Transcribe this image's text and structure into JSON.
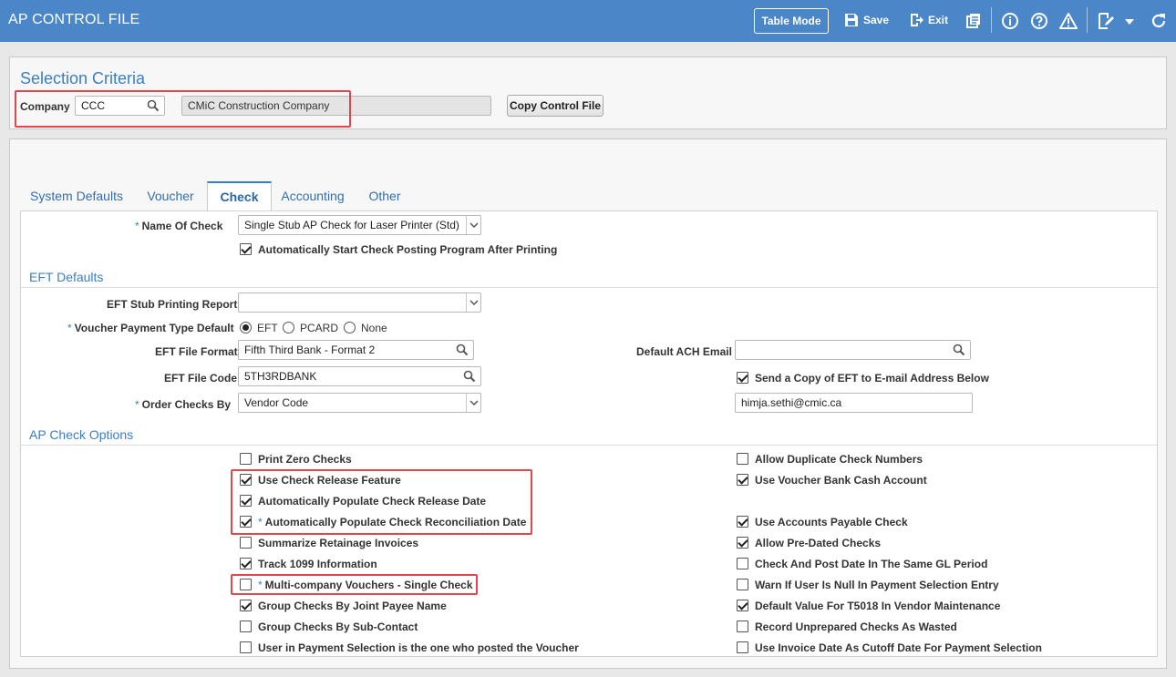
{
  "header": {
    "title": "AP CONTROL FILE",
    "table_mode": "Table Mode",
    "save": "Save",
    "exit": "Exit"
  },
  "selection": {
    "title": "Selection Criteria",
    "company_label": "Company",
    "company_value": "CCC",
    "company_name": "CMiC Construction Company",
    "copy_button": "Copy Control File"
  },
  "tabs": [
    "System Defaults",
    "Voucher",
    "Check",
    "Accounting",
    "Other"
  ],
  "active_tab": "Check",
  "check": {
    "name_of_check_label": "Name Of Check",
    "name_of_check_value": "Single Stub AP Check for Laser Printer (Std)",
    "auto_start_label": "Automatically Start Check Posting Program After Printing",
    "auto_start_checked": true
  },
  "eft": {
    "section_title": "EFT Defaults",
    "stub_report_label": "EFT Stub Printing Report",
    "stub_report_value": "",
    "payment_type_label": "Voucher Payment Type Default",
    "payment_options": [
      "EFT",
      "PCARD",
      "None"
    ],
    "payment_selected": "EFT",
    "file_format_label": "EFT File Format",
    "file_format_value": "Fifth Third Bank - Format 2",
    "file_code_label": "EFT File Code",
    "file_code_value": "5TH3RDBANK",
    "order_checks_label": "Order Checks By",
    "order_checks_value": "Vendor Code",
    "ach_email_label": "Default ACH Email",
    "ach_email_value": "",
    "send_copy_label": "Send a Copy of EFT to E-mail Address Below",
    "send_copy_checked": true,
    "email_value": "himja.sethi@cmic.ca"
  },
  "options": {
    "section_title": "AP Check Options",
    "left": [
      {
        "label": "Print Zero Checks",
        "checked": false,
        "required": false
      },
      {
        "label": "Use Check Release Feature",
        "checked": true,
        "required": false
      },
      {
        "label": "Automatically Populate Check Release Date",
        "checked": true,
        "required": false
      },
      {
        "label": "Automatically Populate Check Reconciliation Date",
        "checked": true,
        "required": true
      },
      {
        "label": "Summarize Retainage Invoices",
        "checked": false,
        "required": false
      },
      {
        "label": "Track 1099 Information",
        "checked": true,
        "required": false
      },
      {
        "label": "Multi-company Vouchers - Single Check",
        "checked": false,
        "required": true
      },
      {
        "label": "Group Checks By Joint Payee Name",
        "checked": true,
        "required": false
      },
      {
        "label": "Group Checks By Sub-Contact",
        "checked": false,
        "required": false
      },
      {
        "label": "User in Payment Selection is the one who posted the Voucher",
        "checked": false,
        "required": false
      }
    ],
    "right": [
      {
        "label": "Allow Duplicate Check Numbers",
        "checked": false
      },
      {
        "label": "Use Voucher Bank Cash Account",
        "checked": true
      },
      null,
      {
        "label": "Use Accounts Payable Check",
        "checked": true
      },
      {
        "label": "Allow Pre-Dated Checks",
        "checked": true
      },
      {
        "label": "Check And Post Date In The Same GL Period",
        "checked": false
      },
      {
        "label": "Warn If User Is Null In Payment Selection Entry",
        "checked": false
      },
      {
        "label": "Default Value For T5018 In Vendor Maintenance",
        "checked": true
      },
      {
        "label": "Record Unprepared Checks As Wasted",
        "checked": false
      },
      {
        "label": "Use Invoice Date As Cutoff Date For Payment Selection",
        "checked": false
      }
    ]
  }
}
